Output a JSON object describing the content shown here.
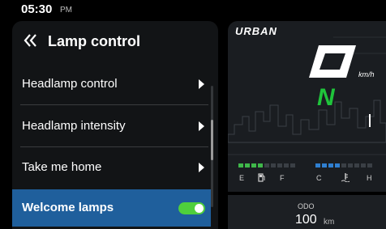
{
  "status_bar": {
    "time": "05:30",
    "ampm": "PM"
  },
  "panel": {
    "title": "Lamp control",
    "items": [
      {
        "label": "Headlamp control"
      },
      {
        "label": "Headlamp intensity"
      },
      {
        "label": "Take me home"
      },
      {
        "label": "Welcome lamps",
        "toggle_on": true
      }
    ]
  },
  "cluster": {
    "brand": "URBAN",
    "speed": "0",
    "speed_unit": "km/h",
    "gear": "N",
    "fuel_gauge": {
      "left_label": "E",
      "right_label": "F",
      "level_fraction": 0.4
    },
    "temp_gauge": {
      "left_label": "C",
      "right_label": "H",
      "level_fraction": 0.4
    },
    "odo": {
      "label": "ODO",
      "value": "100",
      "unit": "km"
    }
  },
  "colors": {
    "accent_blue": "#1f5f9c",
    "toggle_green": "#4fcf3c",
    "gear_green": "#1fc43b",
    "temp_blue": "#2f7fd0"
  },
  "icons": {
    "back": "double-chevron-left-icon",
    "chevron": "chevron-right-icon",
    "fuel": "fuel-pump-icon",
    "temp": "thermometer-icon"
  }
}
